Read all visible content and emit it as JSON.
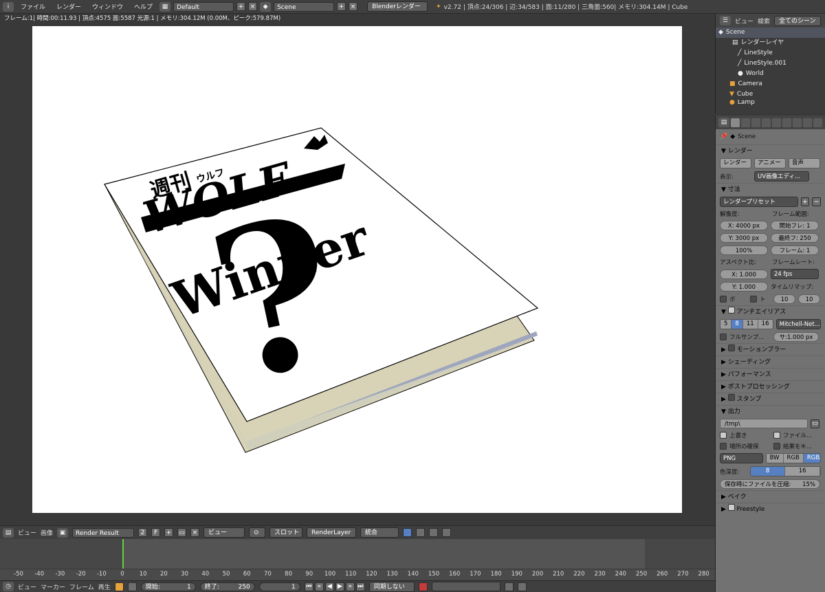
{
  "topbar": {
    "menus": [
      "ファイル",
      "レンダー",
      "ウィンドウ",
      "ヘルプ"
    ],
    "layout": "Default",
    "scene": "Scene",
    "engine": "Blenderレンダー",
    "stats": "v2.72 | 頂点:24/306 | 辺:34/583 | 面:11/280 | 三角面:560| メモリ:304.14M | Cube"
  },
  "infobar": {
    "text": "フレーム:1| 時間:00:11.93 | 頂点:4575 面:5587 光源:1 | メモリ:304.12M (0.00M、ピーク:579.87M)"
  },
  "cover": {
    "title_jp": "週刊",
    "title_sub": "ウルフ",
    "title_main": "WOLF",
    "question": "?",
    "winner": "Winner"
  },
  "image_header": {
    "view": "ビュー",
    "image": "画像",
    "render_result": "Render Result",
    "users": "2",
    "fake": "F",
    "view2": "ビュー",
    "slot": "スロット",
    "layer": "RenderLayer",
    "pass": "統合"
  },
  "timeline": {
    "ticks": [
      "-50",
      "-40",
      "-30",
      "-20",
      "-10",
      "0",
      "10",
      "20",
      "30",
      "40",
      "50",
      "60",
      "70",
      "80",
      "90",
      "100",
      "110",
      "120",
      "130",
      "140",
      "150",
      "160",
      "170",
      "180",
      "190",
      "200",
      "210",
      "220",
      "230",
      "240",
      "250",
      "260",
      "270",
      "280"
    ]
  },
  "playbar": {
    "view": "ビュー",
    "marker": "マーカー",
    "frame": "フレーム",
    "play": "再生",
    "start_label": "開始:",
    "start": "1",
    "end_label": "終了:",
    "end": "250",
    "current": "1",
    "sync": "同期しない"
  },
  "outliner": {
    "view": "ビュー",
    "search": "検索",
    "filter": "全てのシーン",
    "items": [
      {
        "label": "Scene",
        "indent": 0
      },
      {
        "label": "レンダーレイヤ",
        "indent": 1
      },
      {
        "label": "LineStyle",
        "indent": 1
      },
      {
        "label": "LineStyle.001",
        "indent": 1
      },
      {
        "label": "World",
        "indent": 1
      },
      {
        "label": "Camera",
        "indent": 1
      },
      {
        "label": "Cube",
        "indent": 1
      },
      {
        "label": "Lamp",
        "indent": 1
      }
    ]
  },
  "props": {
    "scene": "Scene",
    "render_section": "レンダー",
    "render_btn": "レンダー",
    "anim_btn": "アニメー",
    "audio_btn": "音声",
    "display_label": "表示:",
    "display_value": "UV画像エディ...",
    "dimensions": "寸法",
    "preset": "レンダープリセット",
    "res_label": "解像度:",
    "frame_range_label": "フレーム範囲:",
    "res_x": "X:  4000 px",
    "res_y": "Y:  3000 px",
    "res_pct": "100%",
    "start_frame": "開始フレ:  1",
    "end_frame": "最終フ: 250",
    "frame_step": "フレーム:  1",
    "aspect_label": "アスペクト比:",
    "framerate_label": "フレームレート:",
    "aspect_x": "X:    1.000",
    "aspect_y": "Y:    1.000",
    "fps": "24 fps",
    "remap_label": "タイムリマップ:",
    "remap_old": "10",
    "remap_new": "10",
    "border": "ボ",
    "crop": "ト",
    "aa_section": "アンチエイリアス",
    "aa_samples": [
      "5",
      "8",
      "11",
      "16"
    ],
    "aa_filter": "Mitchell-Net...",
    "full_sample": "フルサンプ...",
    "filter_size": "サ:1.000 px",
    "sections": [
      "モーションブラー",
      "シェーディング",
      "パフォーマンス",
      "ポストプロセッシング",
      "スタンプ"
    ],
    "output_section": "出力",
    "output_path": "/tmp\\",
    "overwrite": "上書き",
    "file_ext": "ファイル...",
    "placeholders": "場所の確保",
    "cache_result": "結果をキ...",
    "format": "PNG",
    "color_modes": [
      "BW",
      "RGB",
      "RGBA"
    ],
    "depth_label": "色深度:",
    "depth_values": [
      "8",
      "16"
    ],
    "compression": "保存時にファイルを圧縮:",
    "compression_value": "15%",
    "bake": "ベイク",
    "freestyle": "Freestyle"
  }
}
